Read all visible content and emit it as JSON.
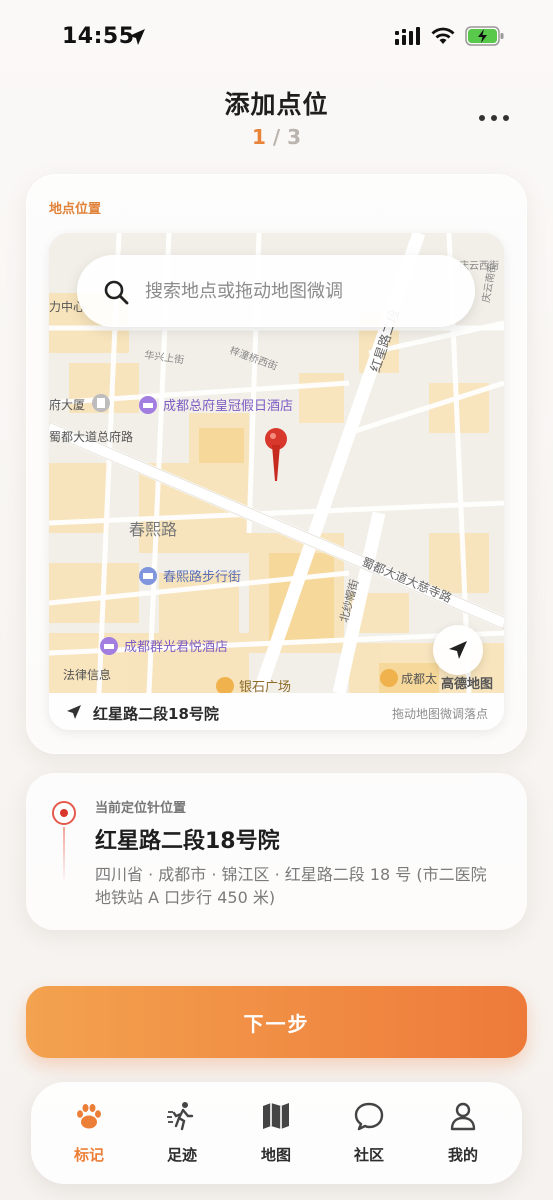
{
  "status_bar": {
    "time": "14:55"
  },
  "header": {
    "title": "添加点位",
    "step_current": "1",
    "step_sep": " / ",
    "step_total": "3"
  },
  "location_card": {
    "label": "地点位置",
    "search_placeholder": "搜索地点或拖动地图微调",
    "map_labels": {
      "zhongxin": "力中心",
      "dasha": "府大厦",
      "avenue_left": "蜀都大道总府路",
      "hotel1": "成都总府皇冠假日酒店",
      "chunxi": "春熙路",
      "chunxi_walk": "春熙路步行街",
      "hotel2": "成都群光君悦酒店",
      "falv": "法律信息",
      "yinshi": "银石广场",
      "chengdu_tai": "成都太",
      "dacisi": "蜀都大道大慈寺路",
      "hongxing": "红星路二段",
      "beishajie": "北纱帽街",
      "huaxing": "华兴上街",
      "zizhong": "梓潼桥西街",
      "qingyun": "庆云西街",
      "qingyun_nan": "庆云南街",
      "brand": "高德地图"
    },
    "footer_address": "红星路二段18号院",
    "footer_hint": "拖动地图微调落点"
  },
  "pin_card": {
    "label": "当前定位针位置",
    "title": "红星路二段18号院",
    "detail": "四川省 · 成都市 · 锦江区 · 红星路二段 18 号 (市二医院地铁站 A 口步行 450 米)"
  },
  "next_button": {
    "label": "下一步"
  },
  "tab_bar": {
    "tabs": [
      {
        "label": "标记",
        "icon": "paw-icon",
        "active": true
      },
      {
        "label": "足迹",
        "icon": "walk-icon"
      },
      {
        "label": "地图",
        "icon": "map-icon"
      },
      {
        "label": "社区",
        "icon": "chat-icon"
      },
      {
        "label": "我的",
        "icon": "user-icon"
      }
    ]
  },
  "colors": {
    "accent": "#ee7a3a",
    "pin": "#d8382c",
    "poi": "#9b7ad6"
  }
}
